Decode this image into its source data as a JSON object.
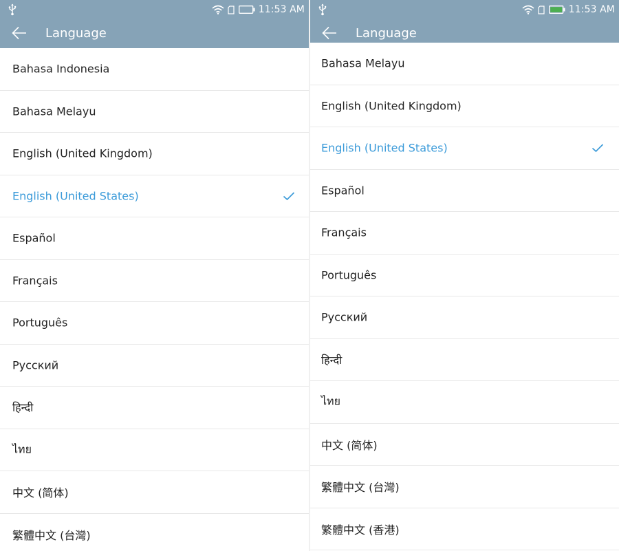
{
  "panels": [
    {
      "status": {
        "time": "11:53 AM",
        "battery_level": 0.0
      },
      "title": "Language",
      "items": [
        {
          "label": "Bahasa Indonesia",
          "selected": false
        },
        {
          "label": "Bahasa Melayu",
          "selected": false
        },
        {
          "label": "English (United Kingdom)",
          "selected": false
        },
        {
          "label": "English (United States)",
          "selected": true
        },
        {
          "label": "Español",
          "selected": false
        },
        {
          "label": "Français",
          "selected": false
        },
        {
          "label": "Português",
          "selected": false
        },
        {
          "label": "Русский",
          "selected": false
        },
        {
          "label": "हिन्दी",
          "selected": false
        },
        {
          "label": "ไทย",
          "selected": false
        },
        {
          "label": "中文 (简体)",
          "selected": false
        },
        {
          "label": "繁體中文 (台灣)",
          "selected": false
        }
      ]
    },
    {
      "status": {
        "time": "11:53 AM",
        "battery_level": 1.0
      },
      "title": "Language",
      "items": [
        {
          "label": "Bahasa Melayu",
          "selected": false
        },
        {
          "label": "English (United Kingdom)",
          "selected": false
        },
        {
          "label": "English (United States)",
          "selected": true
        },
        {
          "label": "Español",
          "selected": false
        },
        {
          "label": "Français",
          "selected": false
        },
        {
          "label": "Português",
          "selected": false
        },
        {
          "label": "Русский",
          "selected": false
        },
        {
          "label": "हिन्दी",
          "selected": false
        },
        {
          "label": "ไทย",
          "selected": false
        },
        {
          "label": "中文 (简体)",
          "selected": false
        },
        {
          "label": "繁體中文 (台灣)",
          "selected": false
        },
        {
          "label": "繁體中文 (香港)",
          "selected": false
        }
      ]
    }
  ],
  "colors": {
    "header": "#86a3b7",
    "accent": "#3a9ad9",
    "battery_fill": "#4caf50",
    "divider": "#e8e8e8"
  },
  "icons": {
    "back": "arrow-left-icon",
    "check": "checkmark-icon",
    "wifi": "wifi-icon",
    "usb": "usb-icon",
    "sim": "sim-card-icon",
    "battery": "battery-icon"
  }
}
